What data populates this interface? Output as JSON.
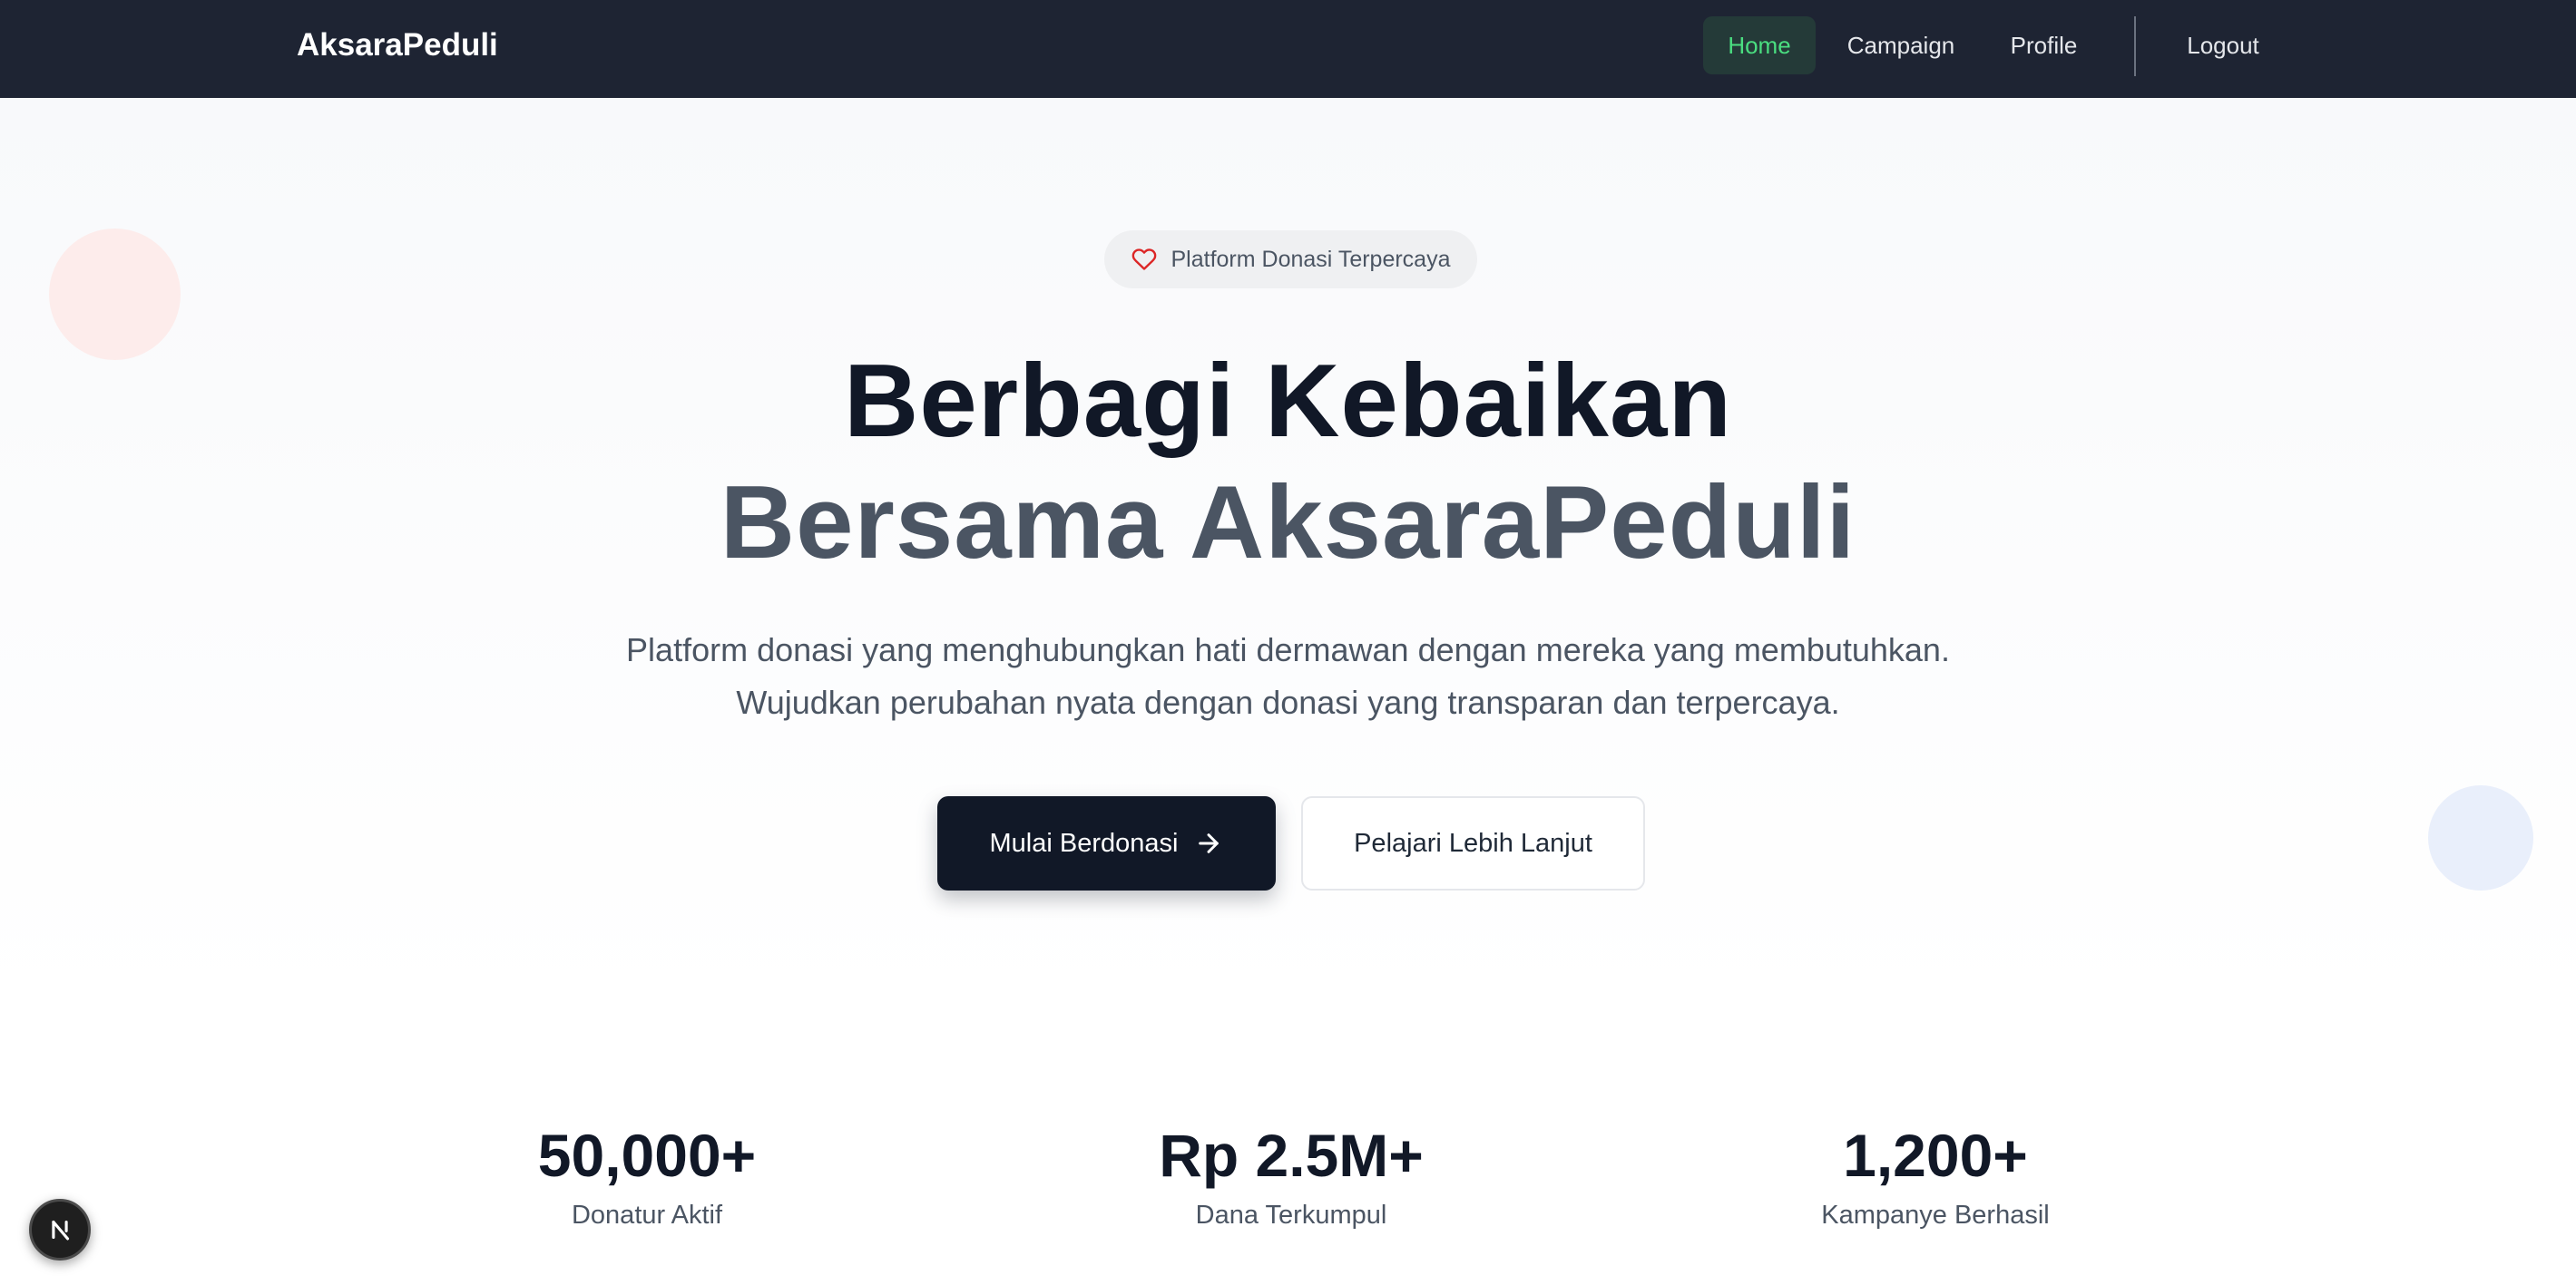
{
  "navbar": {
    "brand": "AksaraPeduli",
    "items": [
      {
        "label": "Home",
        "active": true
      },
      {
        "label": "Campaign",
        "active": false
      },
      {
        "label": "Profile",
        "active": false
      }
    ],
    "logout_label": "Logout",
    "active_color": "#4ade80",
    "background": "#1e2433"
  },
  "hero": {
    "badge": {
      "icon": "heart-icon",
      "text": "Platform Donasi Terpercaya"
    },
    "title_line1": "Berbagi Kebaikan",
    "title_line2": "Bersama AksaraPeduli",
    "subtitle_line1": "Platform donasi yang menghubungkan hati dermawan dengan mereka yang membutuhkan.",
    "subtitle_line2": "Wujudkan perubahan nyata dengan donasi yang transparan dan terpercaya.",
    "primary_button": {
      "label": "Mulai Berdonasi",
      "icon": "arrow-right-icon"
    },
    "secondary_button": {
      "label": "Pelajari Lebih Lanjut"
    }
  },
  "stats": [
    {
      "value": "50,000+",
      "label": "Donatur Aktif"
    },
    {
      "value": "Rp 2.5M+",
      "label": "Dana Terkumpul"
    },
    {
      "value": "1,200+",
      "label": "Kampanye Berhasil"
    }
  ],
  "dev_badge": {
    "icon": "nextjs-logo-icon"
  }
}
